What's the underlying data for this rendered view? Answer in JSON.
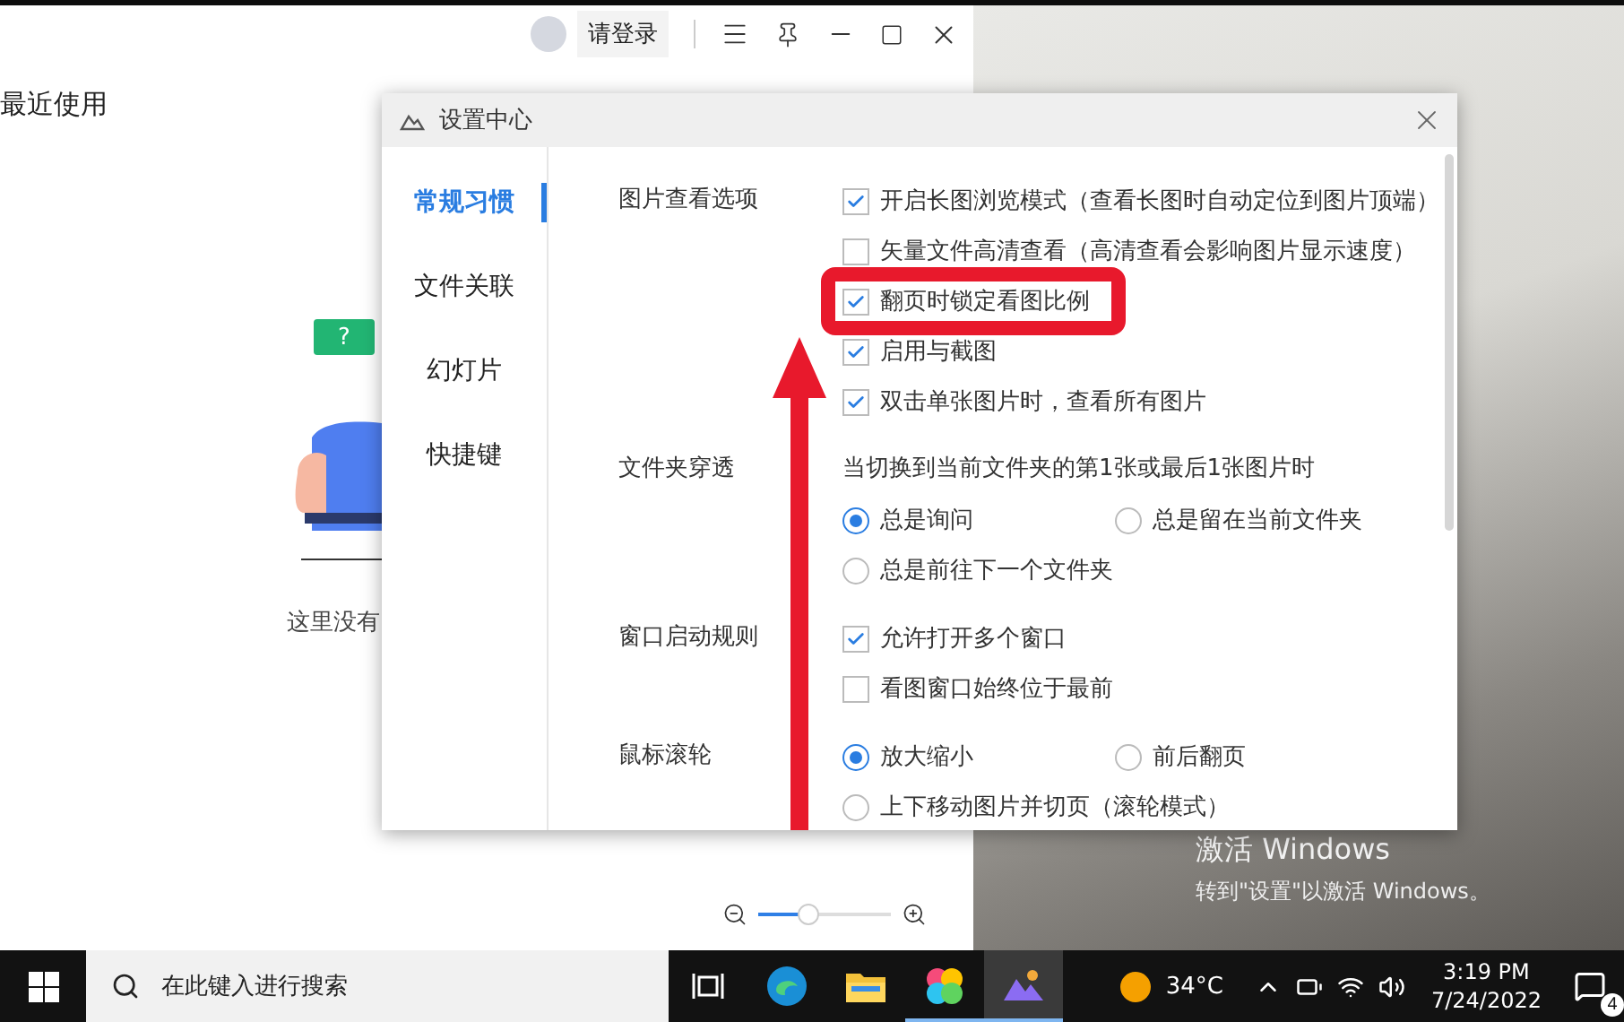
{
  "app": {
    "login": "请登录",
    "recent_title": "最近使用",
    "bubble": "?",
    "empty_text": "这里没有",
    "zoom": {
      "level": 0.38
    }
  },
  "dialog": {
    "title": "设置中心",
    "nav": [
      {
        "label": "常规习惯",
        "selected": true
      },
      {
        "label": "文件关联",
        "selected": false
      },
      {
        "label": "幻灯片",
        "selected": false
      },
      {
        "label": "快捷键",
        "selected": false
      }
    ],
    "sections": [
      {
        "label": "图片查看选项",
        "options": [
          {
            "kind": "checkbox",
            "label": "开启长图浏览模式（查看长图时自动定位到图片顶端）",
            "checked": true,
            "highlighted": false
          },
          {
            "kind": "checkbox",
            "label": "矢量文件高清查看（高清查看会影响图片显示速度）",
            "checked": false,
            "highlighted": false
          },
          {
            "kind": "checkbox",
            "label": "翻页时锁定看图比例",
            "checked": true,
            "highlighted": true
          },
          {
            "kind": "checkbox",
            "label": "启用与截图",
            "checked": true,
            "highlighted": false
          },
          {
            "kind": "checkbox",
            "label": "双击单张图片时，查看所有图片",
            "checked": true,
            "highlighted": false
          }
        ]
      },
      {
        "label": "文件夹穿透",
        "hint": "当切换到当前文件夹的第1张或最后1张图片时",
        "options": [
          {
            "kind": "radio",
            "label": "总是询问",
            "selected": true,
            "highlighted": false
          },
          {
            "kind": "radio",
            "label": "总是留在当前文件夹",
            "selected": false,
            "highlighted": false
          },
          {
            "kind": "radio",
            "label": "总是前往下一个文件夹",
            "selected": false,
            "highlighted": false
          }
        ]
      },
      {
        "label": "窗口启动规则",
        "options": [
          {
            "kind": "checkbox",
            "label": "允许打开多个窗口",
            "checked": true,
            "highlighted": false
          },
          {
            "kind": "checkbox",
            "label": "看图窗口始终位于最前",
            "checked": false,
            "highlighted": false
          }
        ]
      },
      {
        "label": "鼠标滚轮",
        "options": [
          {
            "kind": "radio",
            "label": "放大缩小",
            "selected": true,
            "highlighted": false
          },
          {
            "kind": "radio",
            "label": "前后翻页",
            "selected": false,
            "highlighted": false
          },
          {
            "kind": "radio",
            "label": "上下移动图片并切页（滚轮模式）",
            "selected": false,
            "highlighted": false
          }
        ]
      }
    ]
  },
  "activation": {
    "title": "激活 Windows",
    "text": "转到\"设置\"以激活 Windows。"
  },
  "taskbar": {
    "search_placeholder": "在此键入进行搜索",
    "apps": [
      {
        "kind": "task-view",
        "running": false,
        "active": false
      },
      {
        "kind": "browser",
        "running": false,
        "active": false
      },
      {
        "kind": "folder",
        "running": false,
        "active": false
      },
      {
        "kind": "pinwheel",
        "running": true,
        "active": false
      },
      {
        "kind": "photo",
        "running": true,
        "active": true
      }
    ],
    "weather": "34°C",
    "time": "3:19 PM",
    "date": "7/24/2022",
    "notifications": "4"
  }
}
